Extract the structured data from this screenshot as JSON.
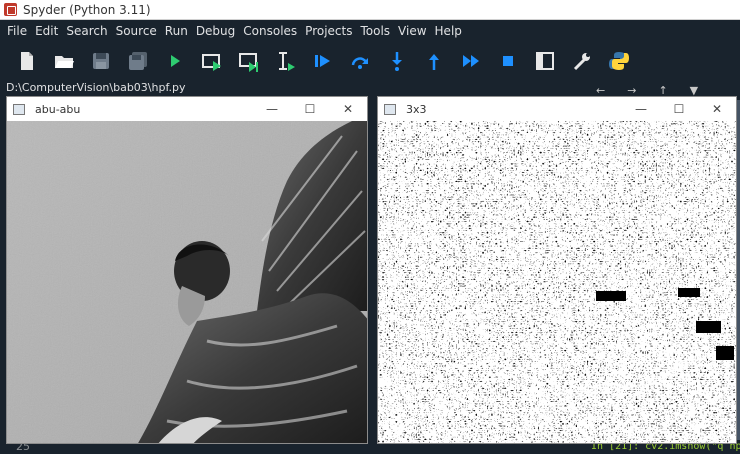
{
  "app": {
    "title": "Spyder (Python 3.11)"
  },
  "menu": [
    "File",
    "Edit",
    "Search",
    "Source",
    "Run",
    "Debug",
    "Consoles",
    "Projects",
    "Tools",
    "View",
    "Help"
  ],
  "toolbar_icons": [
    "new-file-icon",
    "open-folder-icon",
    "save-icon",
    "save-all-icon",
    "run-icon",
    "run-cell-icon",
    "run-cell-advance-icon",
    "run-selection-icon",
    "debug-icon",
    "step-over-icon",
    "step-into-icon",
    "step-return-icon",
    "continue-icon",
    "stop-icon",
    "maximize-pane-icon",
    "preferences-icon",
    "python-path-icon"
  ],
  "editor": {
    "path": "D:\\ComputerVision\\bab03\\hpf.py",
    "line_number": "25"
  },
  "console": {
    "line": "In [21]: cv2.imshow(\"q hp"
  },
  "windows": [
    {
      "title": "abu-abu",
      "type": "grayscale"
    },
    {
      "title": "3x3",
      "type": "highpass"
    }
  ],
  "colors": {
    "accent": "#1e90ff",
    "run": "#2ecc71",
    "background": "#19232d"
  }
}
